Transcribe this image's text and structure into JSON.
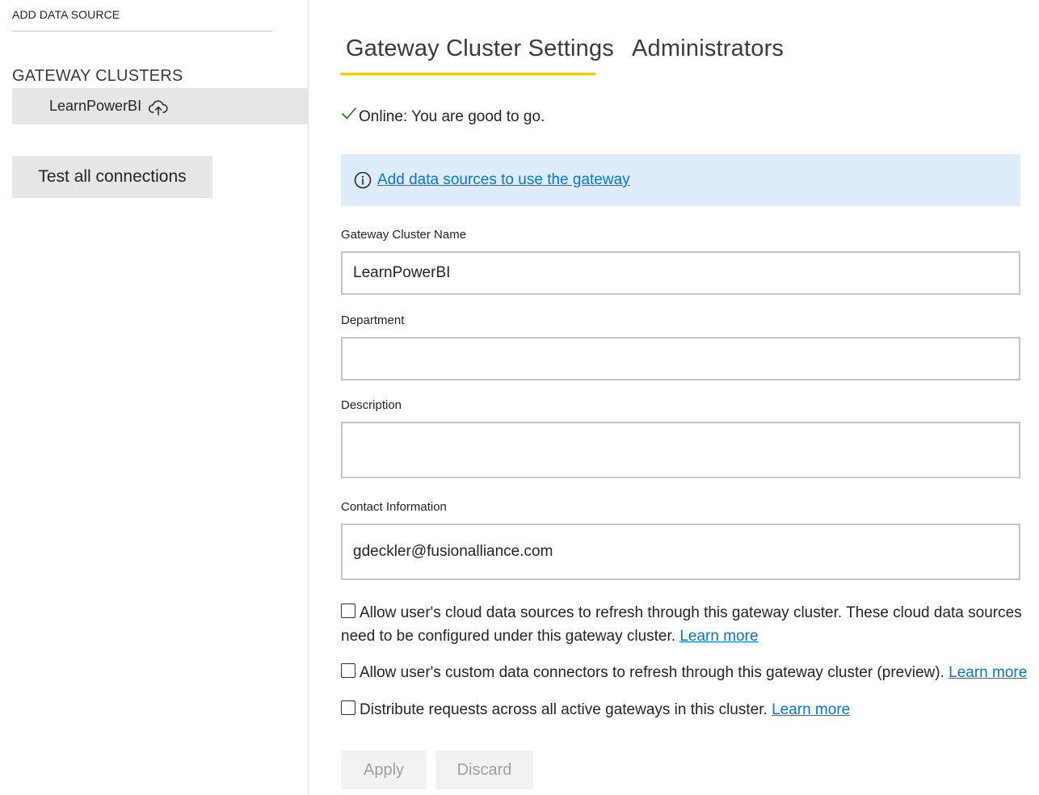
{
  "sidebar": {
    "add_data_source": "ADD DATA SOURCE",
    "clusters_heading": "GATEWAY CLUSTERS",
    "clusters": [
      {
        "name": "LearnPowerBI",
        "icon": "cloud-upload-icon"
      }
    ],
    "test_all_label": "Test all connections"
  },
  "tabs": [
    {
      "label": "Gateway Cluster Settings",
      "active": true
    },
    {
      "label": "Administrators",
      "active": false
    }
  ],
  "status": {
    "icon": "checkmark-icon",
    "text": "Online: You are good to go."
  },
  "info_banner": {
    "icon": "info-icon",
    "link_text": "Add data sources to use the gateway"
  },
  "form": {
    "cluster_name": {
      "label": "Gateway Cluster Name",
      "value": "LearnPowerBI"
    },
    "department": {
      "label": "Department",
      "value": ""
    },
    "description": {
      "label": "Description",
      "value": ""
    },
    "contact": {
      "label": "Contact Information",
      "value": "gdeckler@fusionalliance.com"
    }
  },
  "options": [
    {
      "checked": false,
      "text_line1": "Allow user's cloud data sources to refresh through this gateway cluster. These cloud data sources",
      "text_line2": "need to be configured under this gateway cluster.",
      "link": "Learn more"
    },
    {
      "checked": false,
      "text": "Allow user's custom data connectors to refresh through this gateway cluster (preview).",
      "link": "Learn more"
    },
    {
      "checked": false,
      "text": "Distribute requests across all active gateways in this cluster.",
      "link": "Learn more"
    }
  ],
  "actions": {
    "apply": "Apply",
    "discard": "Discard"
  },
  "colors": {
    "accent_tab": "#f2c811",
    "link": "#0078d4",
    "banner_bg": "#deecf9",
    "success": "#107c10"
  }
}
